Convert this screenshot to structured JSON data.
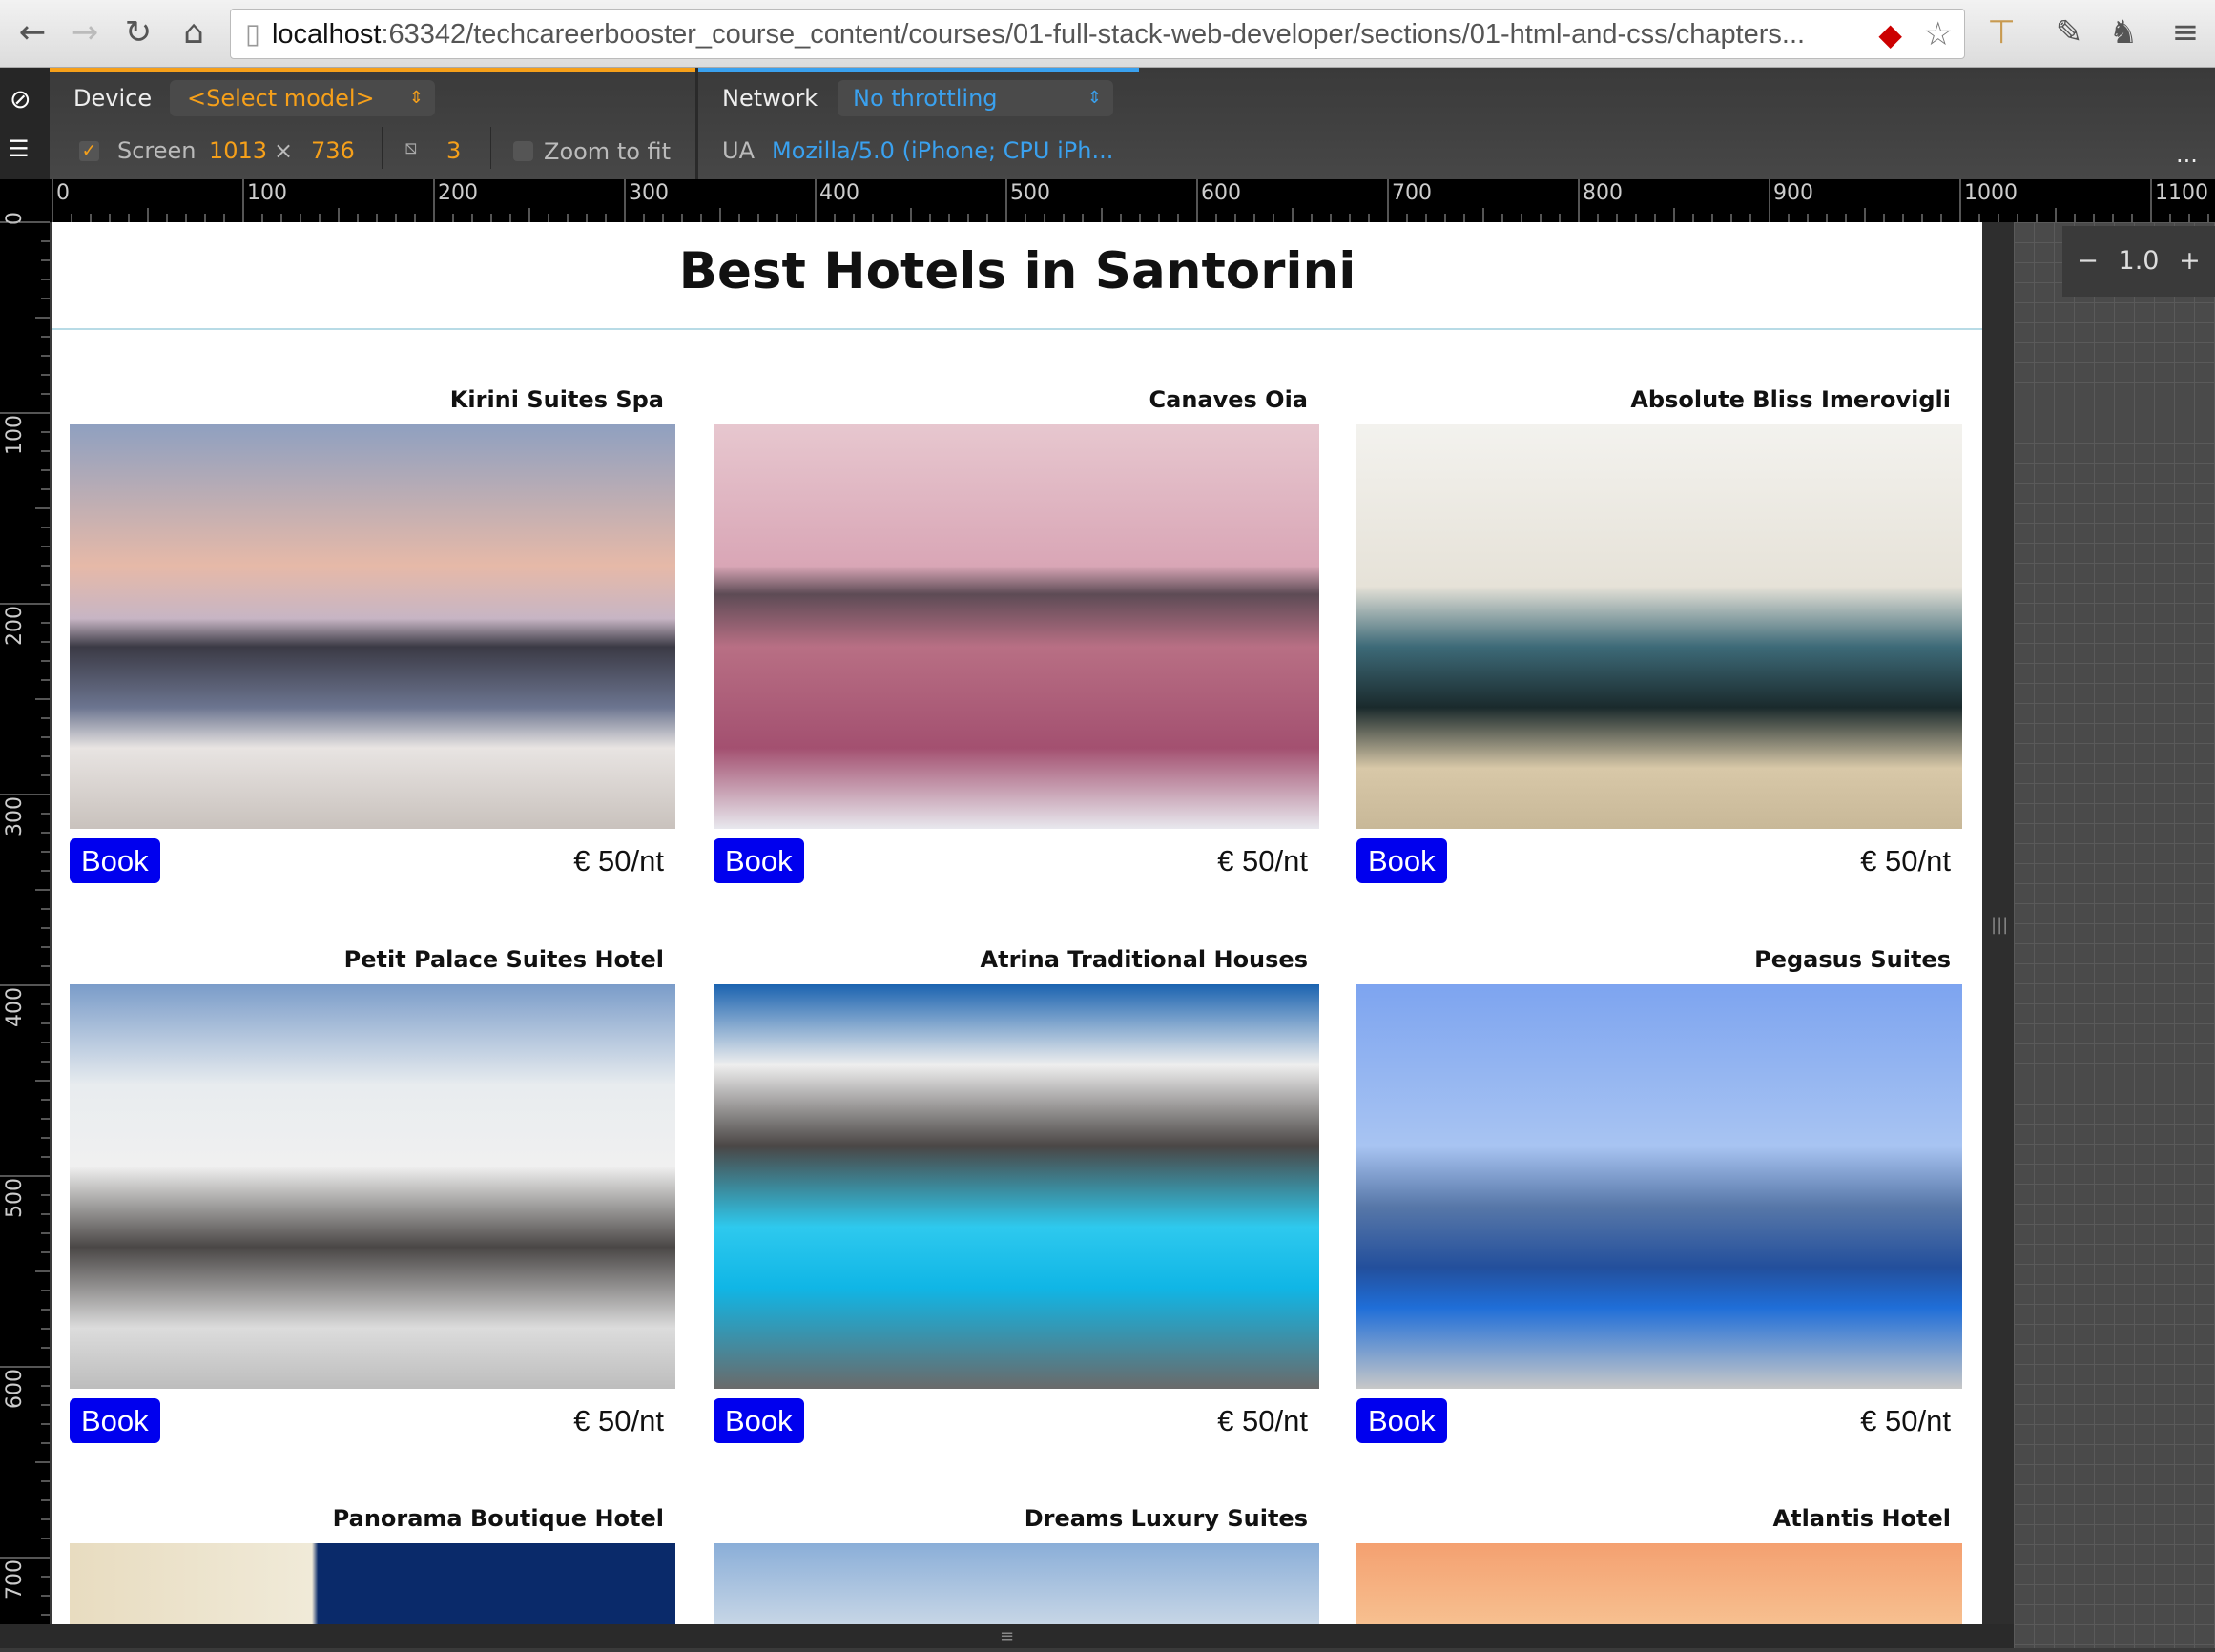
{
  "browser": {
    "url_host": "localhost",
    "url_rest": ":63342/techcareerbooster_course_content/courses/01-full-stack-web-developer/sections/01-html-and-css/chapters..."
  },
  "devtools": {
    "device_label": "Device",
    "device_value": "<Select model>",
    "network_label": "Network",
    "network_value": "No throttling",
    "screen_label": "Screen",
    "screen_width": "1013",
    "screen_x": "×",
    "screen_height": "736",
    "dpr": "3",
    "zoom_to_fit": "Zoom to fit",
    "ua_label": "UA",
    "ua_value": "Mozilla/5.0 (iPhone; CPU iPh...",
    "more": "...",
    "zoom_value": "1.0",
    "zoom_minus": "−",
    "zoom_plus": "+",
    "screen_checked": true,
    "zoom_to_fit_checked": false
  },
  "ruler": {
    "top": [
      "0",
      "100",
      "200",
      "300",
      "400",
      "500",
      "600",
      "700",
      "800",
      "900",
      "1000",
      "1100"
    ],
    "left": [
      "0",
      "100",
      "200",
      "300",
      "400",
      "500",
      "600",
      "700"
    ]
  },
  "page": {
    "title": "Best Hotels in Santorini",
    "hotels": [
      {
        "name": "Kirini Suites Spa",
        "book": "Book",
        "price": "€ 50/nt"
      },
      {
        "name": "Canaves Oia",
        "book": "Book",
        "price": "€ 50/nt"
      },
      {
        "name": "Absolute Bliss Imerovigli",
        "book": "Book",
        "price": "€ 50/nt"
      },
      {
        "name": "Petit Palace Suites Hotel",
        "book": "Book",
        "price": "€ 50/nt"
      },
      {
        "name": "Atrina Traditional Houses",
        "book": "Book",
        "price": "€ 50/nt"
      },
      {
        "name": "Pegasus Suites",
        "book": "Book",
        "price": "€ 50/nt"
      },
      {
        "name": "Panorama Boutique Hotel"
      },
      {
        "name": "Dreams Luxury Suites"
      },
      {
        "name": "Atlantis Hotel"
      }
    ]
  },
  "colors": {
    "book_button": "#0000ee",
    "devtools_orange": "#f6a01a",
    "devtools_blue": "#3aa1ef"
  }
}
